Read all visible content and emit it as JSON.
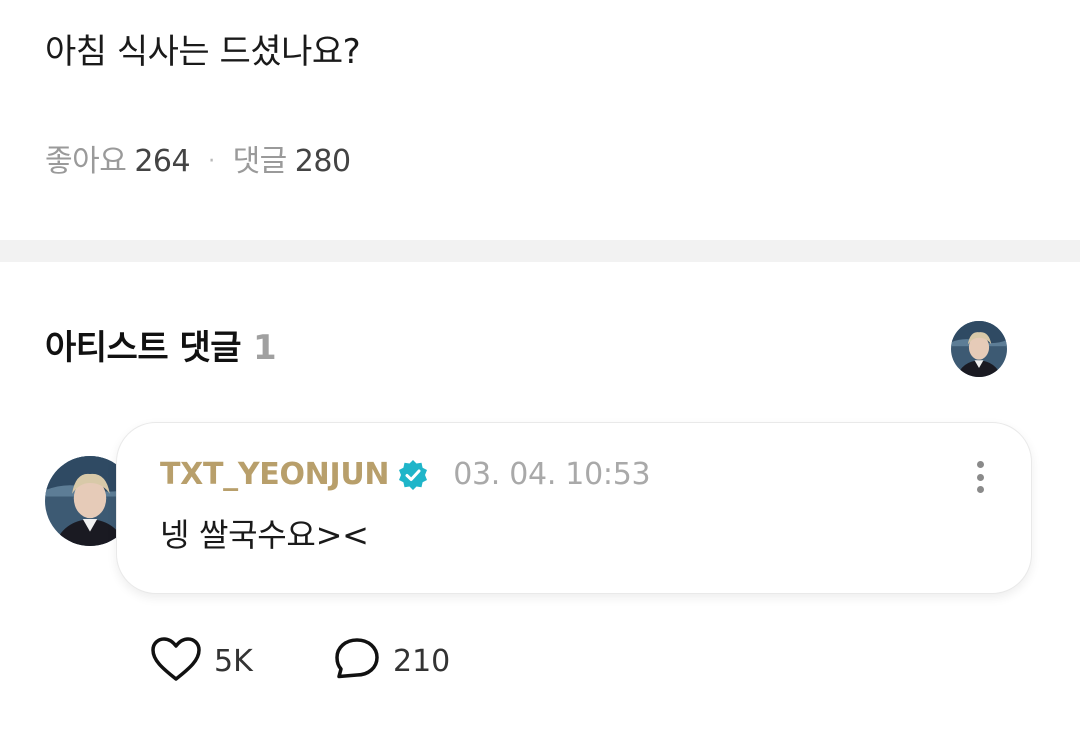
{
  "post": {
    "text": "아침 식사는 드셨나요?",
    "likes_label": "좋아요",
    "likes_count": "264",
    "separator": "·",
    "comments_label": "댓글",
    "comments_count": "280"
  },
  "artist_comments": {
    "title": "아티스트 댓글",
    "count": "1",
    "comments": [
      {
        "author": "TXT_YEONJUN",
        "verified": true,
        "timestamp": "03. 04. 10:53",
        "body": "넹 쌀국수요><",
        "likes": "5K",
        "replies": "210"
      }
    ]
  },
  "colors": {
    "author": "#b89f6b",
    "verified_badge": "#1fb5c9",
    "divider": "#f2f2f2"
  },
  "icons": [
    "verified-badge-icon",
    "more-vertical-icon",
    "heart-icon",
    "comment-bubble-icon"
  ]
}
